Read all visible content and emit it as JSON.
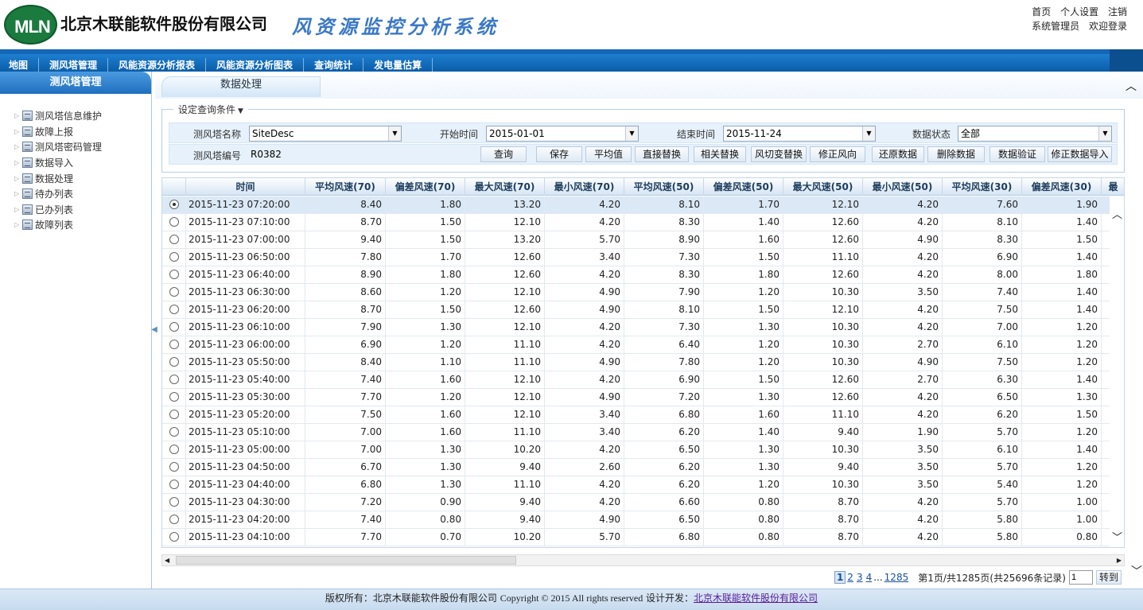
{
  "header": {
    "logo_text": "MLN",
    "company": "北京木联能软件股份有限公司",
    "system": "风资源监控分析系统",
    "links": [
      "首页",
      "个人设置",
      "注销"
    ],
    "user": "系统管理员",
    "welcome": "欢迎登录"
  },
  "nav": [
    "地图",
    "测风塔管理",
    "风能资源分析报表",
    "风能资源分析图表",
    "查询统计",
    "发电量估算"
  ],
  "sidebar": {
    "title": "测风塔管理",
    "items": [
      "测风塔信息维护",
      "故障上报",
      "测风塔密码管理",
      "数据导入",
      "数据处理",
      "待办列表",
      "已办列表",
      "故障列表"
    ]
  },
  "tab": "数据处理",
  "query": {
    "legend": "设定查询条件",
    "tower_name_label": "测风塔名称",
    "tower_name_value": "SiteDesc",
    "start_label": "开始时间",
    "start_value": "2015-01-01",
    "end_label": "结束时间",
    "end_value": "2015-11-24",
    "status_label": "数据状态",
    "status_value": "全部",
    "tower_code_label": "测风塔编号",
    "tower_code_value": "R0382",
    "buttons": [
      "查询",
      "保存",
      "平均值",
      "直接替换",
      "相关替换",
      "风切变替换",
      "修正风向",
      "还原数据",
      "删除数据",
      "数据验证",
      "修正数据导入"
    ]
  },
  "grid": {
    "columns": [
      "时间",
      "平均风速(70)",
      "偏差风速(70)",
      "最大风速(70)",
      "最小风速(70)",
      "平均风速(50)",
      "偏差风速(50)",
      "最大风速(50)",
      "最小风速(50)",
      "平均风速(30)",
      "偏差风速(30)",
      "最"
    ],
    "rows": [
      [
        "2015-11-23 07:20:00",
        "8.40",
        "1.80",
        "13.20",
        "4.20",
        "8.10",
        "1.70",
        "12.10",
        "4.20",
        "7.60",
        "1.90"
      ],
      [
        "2015-11-23 07:10:00",
        "8.70",
        "1.50",
        "12.10",
        "4.20",
        "8.30",
        "1.40",
        "12.60",
        "4.20",
        "8.10",
        "1.40"
      ],
      [
        "2015-11-23 07:00:00",
        "9.40",
        "1.50",
        "13.20",
        "5.70",
        "8.90",
        "1.60",
        "12.60",
        "4.90",
        "8.30",
        "1.50"
      ],
      [
        "2015-11-23 06:50:00",
        "7.80",
        "1.70",
        "12.60",
        "3.40",
        "7.30",
        "1.50",
        "11.10",
        "4.20",
        "6.90",
        "1.40"
      ],
      [
        "2015-11-23 06:40:00",
        "8.90",
        "1.80",
        "12.60",
        "4.20",
        "8.30",
        "1.80",
        "12.60",
        "4.20",
        "8.00",
        "1.80"
      ],
      [
        "2015-11-23 06:30:00",
        "8.60",
        "1.20",
        "12.10",
        "4.90",
        "7.90",
        "1.20",
        "10.30",
        "3.50",
        "7.40",
        "1.40"
      ],
      [
        "2015-11-23 06:20:00",
        "8.70",
        "1.50",
        "12.60",
        "4.90",
        "8.10",
        "1.50",
        "12.10",
        "4.20",
        "7.50",
        "1.40"
      ],
      [
        "2015-11-23 06:10:00",
        "7.90",
        "1.30",
        "12.10",
        "4.20",
        "7.30",
        "1.30",
        "10.30",
        "4.20",
        "7.00",
        "1.20"
      ],
      [
        "2015-11-23 06:00:00",
        "6.90",
        "1.20",
        "11.10",
        "4.20",
        "6.40",
        "1.20",
        "10.30",
        "2.70",
        "6.10",
        "1.20"
      ],
      [
        "2015-11-23 05:50:00",
        "8.40",
        "1.10",
        "11.10",
        "4.90",
        "7.80",
        "1.20",
        "10.30",
        "4.90",
        "7.50",
        "1.20"
      ],
      [
        "2015-11-23 05:40:00",
        "7.40",
        "1.60",
        "12.10",
        "4.20",
        "6.90",
        "1.50",
        "12.60",
        "2.70",
        "6.30",
        "1.40"
      ],
      [
        "2015-11-23 05:30:00",
        "7.70",
        "1.20",
        "12.10",
        "4.90",
        "7.20",
        "1.30",
        "12.60",
        "4.20",
        "6.50",
        "1.30"
      ],
      [
        "2015-11-23 05:20:00",
        "7.50",
        "1.60",
        "12.10",
        "3.40",
        "6.80",
        "1.60",
        "11.10",
        "4.20",
        "6.20",
        "1.50"
      ],
      [
        "2015-11-23 05:10:00",
        "7.00",
        "1.60",
        "11.10",
        "3.40",
        "6.20",
        "1.40",
        "9.40",
        "1.90",
        "5.70",
        "1.20"
      ],
      [
        "2015-11-23 05:00:00",
        "7.00",
        "1.30",
        "10.20",
        "4.20",
        "6.50",
        "1.30",
        "10.30",
        "3.50",
        "6.10",
        "1.40"
      ],
      [
        "2015-11-23 04:50:00",
        "6.70",
        "1.30",
        "9.40",
        "2.60",
        "6.20",
        "1.30",
        "9.40",
        "3.50",
        "5.70",
        "1.20"
      ],
      [
        "2015-11-23 04:40:00",
        "6.80",
        "1.30",
        "11.10",
        "4.20",
        "6.20",
        "1.20",
        "10.30",
        "3.50",
        "5.40",
        "1.20"
      ],
      [
        "2015-11-23 04:30:00",
        "7.20",
        "0.90",
        "9.40",
        "4.20",
        "6.60",
        "0.80",
        "8.70",
        "4.20",
        "5.70",
        "1.00"
      ],
      [
        "2015-11-23 04:20:00",
        "7.40",
        "0.80",
        "9.40",
        "4.90",
        "6.50",
        "0.80",
        "8.70",
        "4.20",
        "5.80",
        "1.00"
      ],
      [
        "2015-11-23 04:10:00",
        "7.70",
        "0.70",
        "10.20",
        "5.70",
        "6.80",
        "0.80",
        "8.70",
        "4.20",
        "5.80",
        "0.80"
      ]
    ],
    "selected_row": 0
  },
  "pager": {
    "pages": [
      "1",
      "2",
      "3",
      "4"
    ],
    "ellipsis": "...",
    "last": "1285",
    "summary": "第1页/共1285页(共25696条记录)",
    "input_value": "1",
    "go": "转到"
  },
  "footer": {
    "prefix": "版权所有：北京木联能软件股份有限公司",
    "copyright": "Copyright © 2015 All rights reserved",
    "dev_label": "设计开发：",
    "dev_link": "北京木联能软件股份有限公司"
  },
  "colors": {
    "nav_bg": "#0b5da8",
    "accent": "#3a78c8",
    "logo": "#1b7a3e"
  }
}
